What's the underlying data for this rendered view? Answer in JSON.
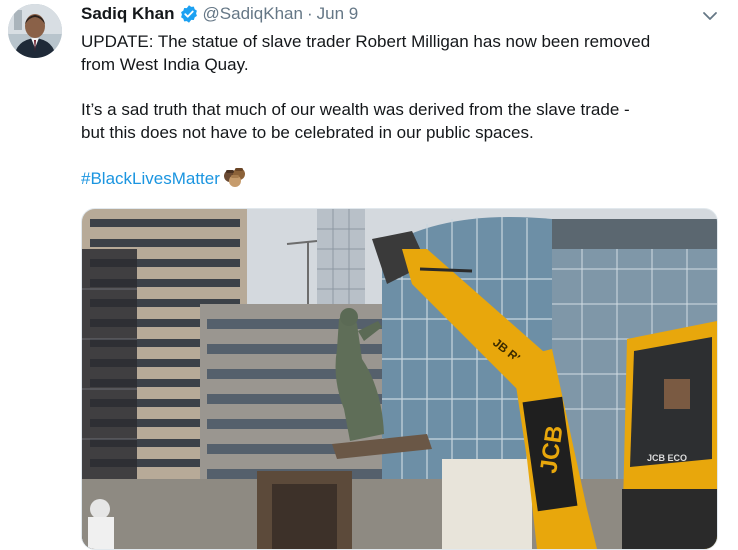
{
  "tweet": {
    "author_name": "Sadiq Khan",
    "handle": "@SadiqKhan",
    "separator": "·",
    "date": "Jun 9",
    "line1": "UPDATE: The statue of slave trader Robert Milligan has now been removed",
    "line2": "from West India Quay.",
    "line3": "It’s a sad truth that much of our wealth was derived from the slave trade -",
    "line4": "but this does not have to be celebrated in our public spaces.",
    "hashtag": "#BlackLivesMatter"
  },
  "icons": {
    "verified": "verified-badge-icon",
    "caret": "chevron-down-icon",
    "fist": "raised-fist-emoji"
  },
  "video": {
    "machine_label": "JCB",
    "arm_label": "JB RINK",
    "cab_label": "JCB ECO"
  },
  "colors": {
    "link": "#1b95e0",
    "secondary_text": "#657786",
    "jcb_yellow": "#e8a70c",
    "verified_blue": "#1da1f2"
  }
}
